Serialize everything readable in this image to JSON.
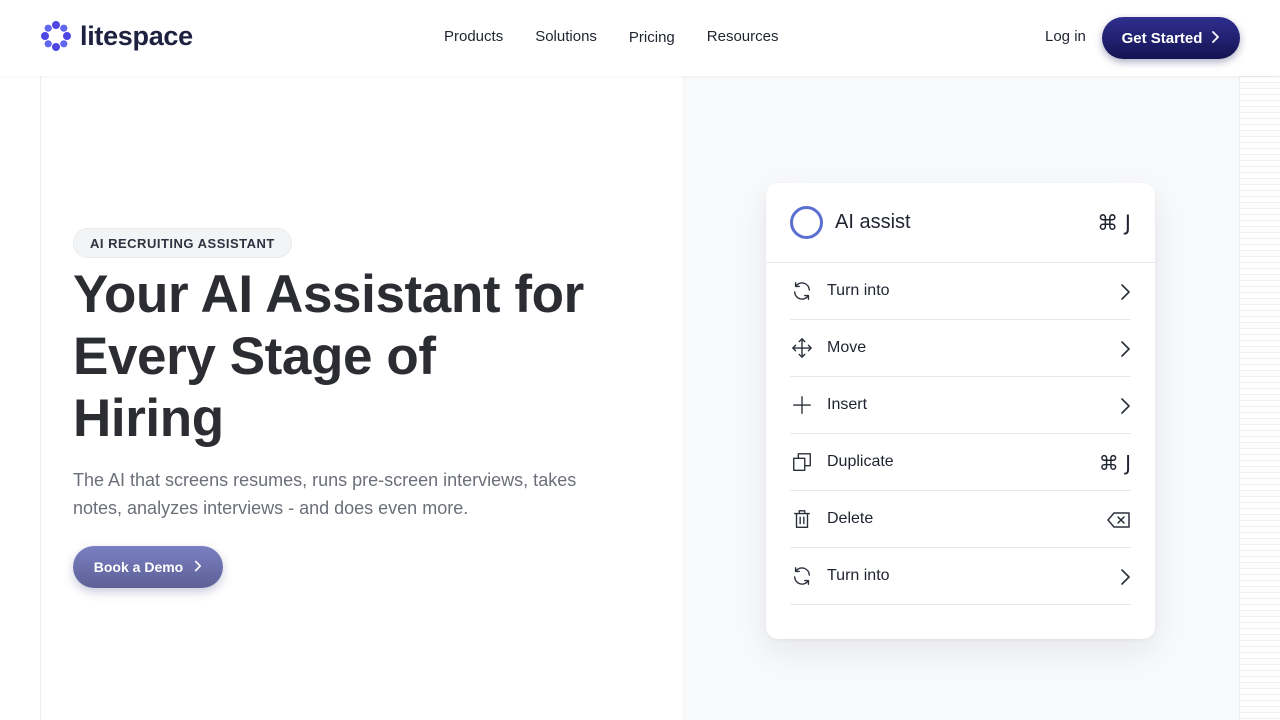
{
  "brand": {
    "name": "litespace",
    "color": "#4f46e5"
  },
  "nav": {
    "items": [
      "Products",
      "Solutions",
      "Pricing",
      "Resources"
    ]
  },
  "header": {
    "login": "Log in",
    "cta": "Get Started"
  },
  "hero": {
    "badge": "AI RECRUITING ASSISTANT",
    "title": "Your AI Assistant for Every Stage of Hiring",
    "subtitle": "The AI that screens resumes, runs pre-screen interviews, takes notes, analyzes interviews - and does even more.",
    "button": "Book a Demo"
  },
  "menu": {
    "title": "AI assist",
    "shortcut": "⌘ J",
    "items": [
      {
        "label": "Turn into",
        "icon": "refresh-icon",
        "right": "chevron"
      },
      {
        "label": "Move",
        "icon": "move-icon",
        "right": "chevron"
      },
      {
        "label": "Insert",
        "icon": "plus-icon",
        "right": "chevron"
      },
      {
        "label": "Duplicate",
        "icon": "duplicate-icon",
        "right": "⌘ J"
      },
      {
        "label": "Delete",
        "icon": "trash-icon",
        "right": "backspace"
      },
      {
        "label": "Turn into",
        "icon": "refresh-icon",
        "right": "chevron"
      }
    ]
  }
}
